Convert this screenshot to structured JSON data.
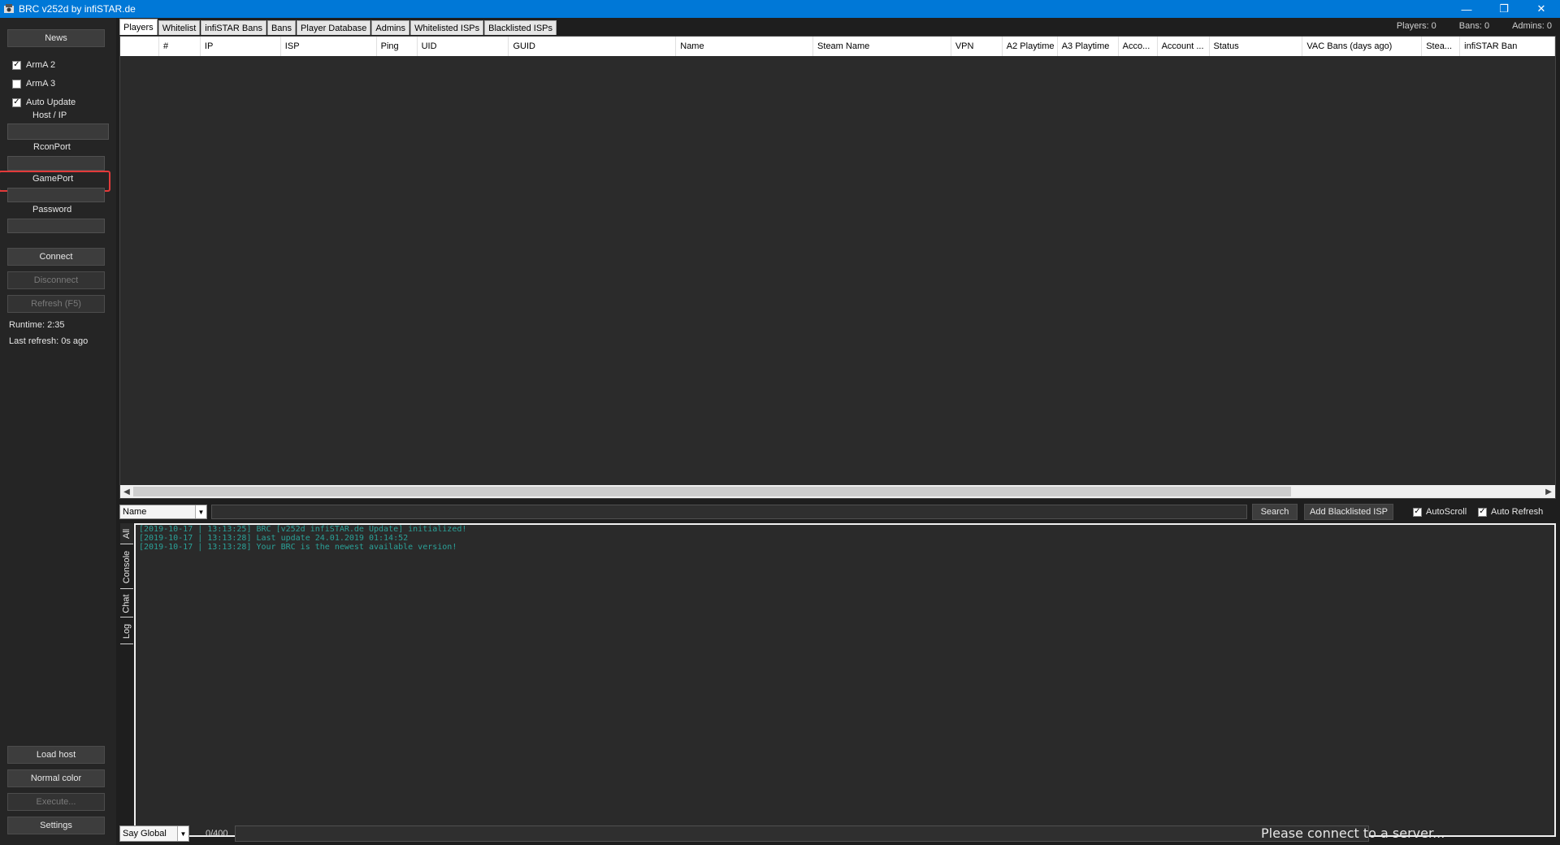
{
  "window": {
    "title": "BRC v252d by infiSTAR.de",
    "minimize": "—",
    "restore": "❐",
    "close": "✕"
  },
  "sidebar": {
    "news": "News",
    "arma2": "ArmA 2",
    "arma2_checked": true,
    "arma3": "ArmA 3",
    "arma3_checked": false,
    "auto_update": "Auto Update",
    "auto_update_checked": true,
    "host_label": "Host / IP",
    "rcon_label": "RconPort",
    "gameport_label": "GamePort",
    "password_label": "Password",
    "connect": "Connect",
    "disconnect": "Disconnect",
    "refresh": "Refresh (F5)",
    "runtime": "Runtime: 2:35",
    "last_refresh": "Last refresh: 0s ago",
    "load_host": "Load host",
    "normal_color": "Normal color",
    "execute": "Execute...",
    "settings": "Settings"
  },
  "tabs": [
    "Players",
    "Whitelist",
    "infiSTAR Bans",
    "Bans",
    "Player Database",
    "Admins",
    "Whitelisted ISPs",
    "Blacklisted ISPs"
  ],
  "stats": {
    "players": "Players: 0",
    "bans": "Bans: 0",
    "admins": "Admins: 0"
  },
  "columns": [
    "#",
    "IP",
    "ISP",
    "Ping",
    "UID",
    "GUID",
    "Name",
    "Steam Name",
    "VPN",
    "A2 Playtime",
    "A3 Playtime",
    "Acco...",
    "Account ...",
    "Status",
    "VAC Bans (days ago)",
    "Stea...",
    "infiSTAR Ban"
  ],
  "search": {
    "field": "Name",
    "button": "Search",
    "add_blacklisted": "Add Blacklisted ISP",
    "autoscroll": "AutoScroll",
    "auto_refresh": "Auto Refresh"
  },
  "log_tabs": [
    "All",
    "Console",
    "Chat",
    "Log"
  ],
  "log_lines": [
    "[2019-10-17 | 13:13:25] BRC [v252d infiSTAR.de Update] initialized!",
    "[2019-10-17 | 13:13:28] Last update 24.01.2019 01:14:52",
    "[2019-10-17 | 13:13:28] Your BRC is the newest available version!"
  ],
  "bottom": {
    "say_mode": "Say Global",
    "char_count": "0/400",
    "status": "Please connect to a server..."
  },
  "colors": {
    "titlebar": "#0078d7",
    "log_text": "#2aa198",
    "highlight": "#e23a3a"
  }
}
